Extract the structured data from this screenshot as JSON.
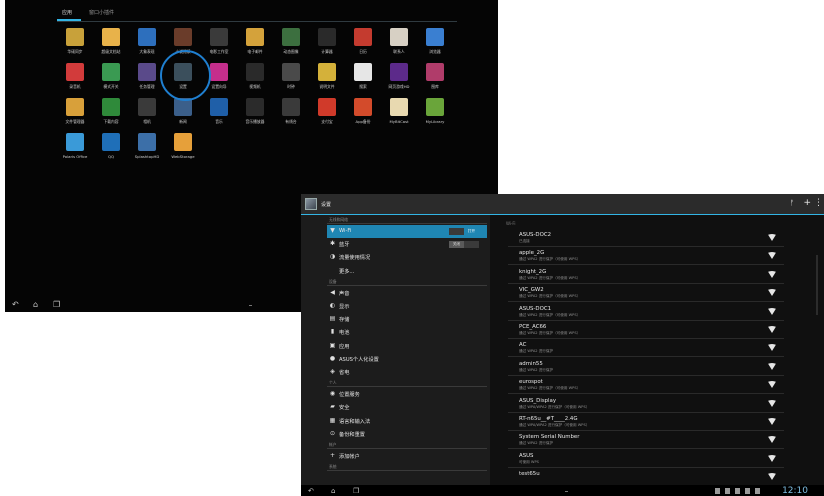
{
  "drawer": {
    "tabs": {
      "apps": "应用",
      "widgets": "窗口小插件"
    },
    "apps": [
      {
        "label": "华硕同步",
        "color": "#c8a13a"
      },
      {
        "label": "超级文档站",
        "color": "#e8b24a"
      },
      {
        "label": "大象表现",
        "color": "#2d6fbd"
      },
      {
        "label": "小说阅读",
        "color": "#6a3c2a"
      },
      {
        "label": "电影工作室",
        "color": "#3a3a3a"
      },
      {
        "label": "电子邮件",
        "color": "#d4a23b"
      },
      {
        "label": "动态图像",
        "color": "#3c6f3f"
      },
      {
        "label": "计算器",
        "color": "#2a2a2a"
      },
      {
        "label": "日历",
        "color": "#c43b2f"
      },
      {
        "label": "联系人",
        "color": "#d7d0c4"
      },
      {
        "label": "浏览器",
        "color": "#3a7fd1"
      },
      {
        "label": "录音机",
        "color": "#d23b3b"
      },
      {
        "label": "模式开关",
        "color": "#3a9a52"
      },
      {
        "label": "任务管理",
        "color": "#5a4a8a"
      },
      {
        "label": "设置",
        "color": "#3b4f5c"
      },
      {
        "label": "设置向导",
        "color": "#c52e8c"
      },
      {
        "label": "视频机",
        "color": "#2a2a2a"
      },
      {
        "label": "时钟",
        "color": "#4a4a4a"
      },
      {
        "label": "说明文件",
        "color": "#d4b13a"
      },
      {
        "label": "搜索",
        "color": "#e6e6e6"
      },
      {
        "label": "网页游戏HD",
        "color": "#5c2a8a"
      },
      {
        "label": "图库",
        "color": "#b03c6a"
      },
      {
        "label": "文件管理器",
        "color": "#d8a03a"
      },
      {
        "label": "下载内容",
        "color": "#2f8a3a"
      },
      {
        "label": "相机",
        "color": "#3a3a3a"
      },
      {
        "label": "新闻",
        "color": "#3b5f8a"
      },
      {
        "label": "音乐",
        "color": "#1f5fa8"
      },
      {
        "label": "音乐播放器",
        "color": "#2b2b2b"
      },
      {
        "label": "有线台",
        "color": "#3a3a3a"
      },
      {
        "label": "支付宝",
        "color": "#d03a2a"
      },
      {
        "label": "App备份",
        "color": "#d34b2b"
      },
      {
        "label": "MyBitCast",
        "color": "#e8d9b0"
      },
      {
        "label": "MyLibrary",
        "color": "#6aa53a"
      },
      {
        "label": "Polaris Office",
        "color": "#3a9ad8"
      },
      {
        "label": "QQ",
        "color": "#1f6fb8"
      },
      {
        "label": "SplashtopHD",
        "color": "#3c6fa8"
      },
      {
        "label": "WebStorage",
        "color": "#e6a03a"
      }
    ]
  },
  "settings": {
    "title": "设置",
    "left": {
      "sections": [
        {
          "header": "无线和网络",
          "items": [
            {
              "label": "Wi-Fi",
              "icon": "wifi-icon",
              "glyph": "▼",
              "active": true,
              "toggle": "打开",
              "toggle_state": "on"
            },
            {
              "label": "蓝牙",
              "icon": "bluetooth-icon",
              "glyph": "✱",
              "toggle": "关闭",
              "toggle_state": "off"
            },
            {
              "label": "流量使用情况",
              "icon": "data-usage-icon",
              "glyph": "◑"
            },
            {
              "label": "更多...",
              "icon": "",
              "glyph": ""
            }
          ]
        },
        {
          "header": "设备",
          "items": [
            {
              "label": "声音",
              "icon": "speaker-icon",
              "glyph": "◀"
            },
            {
              "label": "显示",
              "icon": "display-icon",
              "glyph": "◐"
            },
            {
              "label": "存储",
              "icon": "storage-icon",
              "glyph": "▤"
            },
            {
              "label": "电池",
              "icon": "battery-icon",
              "glyph": "▮"
            },
            {
              "label": "应用",
              "icon": "apps-icon",
              "glyph": "▣"
            },
            {
              "label": "ASUS个人化设置",
              "icon": "asus-settings-icon",
              "glyph": "●"
            },
            {
              "label": "省电",
              "icon": "power-saving-icon",
              "glyph": "◈"
            }
          ]
        },
        {
          "header": "个人",
          "items": [
            {
              "label": "位置服务",
              "icon": "location-icon",
              "glyph": "◉"
            },
            {
              "label": "安全",
              "icon": "lock-icon",
              "glyph": "▰"
            },
            {
              "label": "语言和输入法",
              "icon": "language-icon",
              "glyph": "▦"
            },
            {
              "label": "备份和重置",
              "icon": "backup-icon",
              "glyph": "⊙"
            }
          ]
        },
        {
          "header": "帐户",
          "items": [
            {
              "label": "添加帐户",
              "icon": "add-icon",
              "glyph": "+"
            }
          ]
        },
        {
          "header": "系统",
          "items": []
        }
      ]
    },
    "right": {
      "header": "Wi-Fi",
      "networks": [
        {
          "name": "ASUS-DOC2",
          "status": "已连接"
        },
        {
          "name": "apple_2G",
          "status": "通过 WPA2 进行保护（可使用 WPS）"
        },
        {
          "name": "knight_2G",
          "status": "通过 WPA2 进行保护（可使用 WPS）"
        },
        {
          "name": "VIC_GW2",
          "status": "通过 WPA2 进行保护（可使用 WPS）"
        },
        {
          "name": "ASUS-DOC1",
          "status": "通过 WPA2 进行保护（可使用 WPS）"
        },
        {
          "name": "PCE_AC66",
          "status": "通过 WPA2 进行保护（可使用 WPS）"
        },
        {
          "name": "AC",
          "status": "通过 WPA2 进行保护"
        },
        {
          "name": "admin55",
          "status": "通过 WPA2 进行保护"
        },
        {
          "name": "eurospot",
          "status": "通过 WPA2 进行保护（可使用 WPS）"
        },
        {
          "name": "ASUS_Display",
          "status": "通过 WPA/WPA2 进行保护（可使用 WPS）"
        },
        {
          "name": "RT-n65u__#T____2.4G",
          "status": "通过 WPA/WPA2 进行保护（可使用 WPS）"
        },
        {
          "name": "System Serial Number",
          "status": "通过 WPA2 进行保护"
        },
        {
          "name": "ASUS",
          "status": "可使用 WPS"
        },
        {
          "name": "test65u",
          "status": ""
        }
      ]
    },
    "time": "12:10"
  }
}
